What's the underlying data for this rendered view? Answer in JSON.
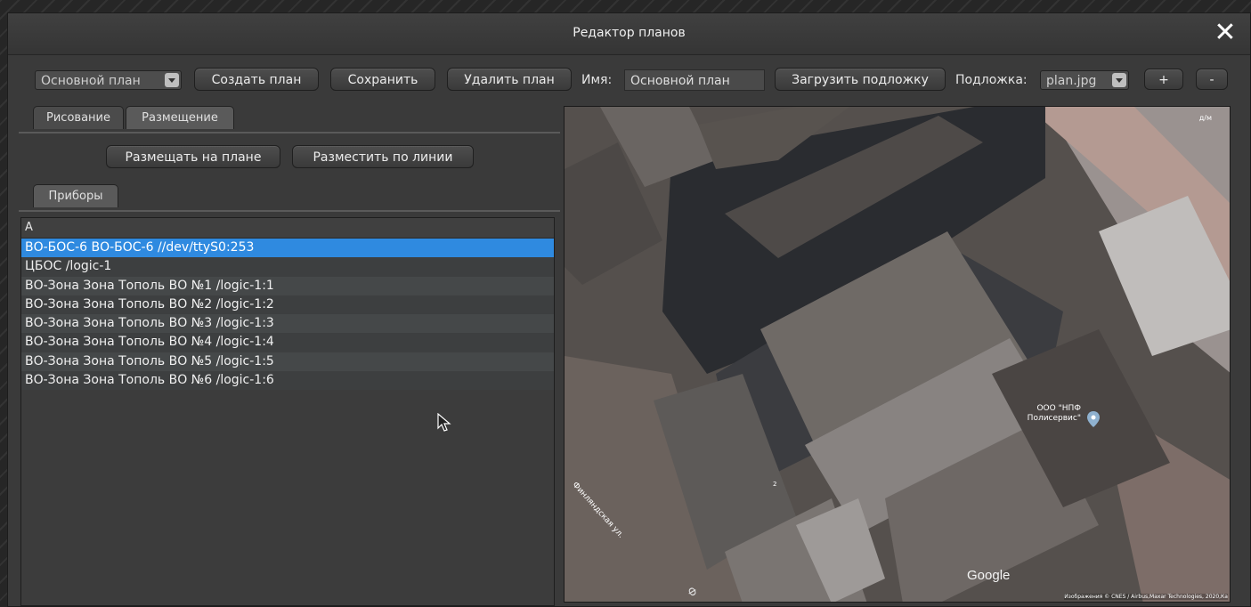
{
  "window": {
    "title": "Редактор планов"
  },
  "toolbar": {
    "plan_select": "Основной план",
    "create_plan": "Создать план",
    "save": "Сохранить",
    "delete_plan": "Удалить план",
    "name_label": "Имя:",
    "name_value": "Основной план",
    "load_background": "Загрузить подложку",
    "background_label": "Подложка:",
    "background_select": "plan.jpg",
    "zoom_in": "+",
    "zoom_out": "-"
  },
  "tabs": [
    {
      "label": "Рисование",
      "active": false
    },
    {
      "label": "Размещение",
      "active": true
    }
  ],
  "placement": {
    "place_on_plan": "Размещать на плане",
    "place_along_line": "Разместить по линии",
    "devices_tab": "Приборы"
  },
  "device_list": {
    "header": "A",
    "items": [
      {
        "label": "ВО-БОС-6 ВО-БОС-6 //dev/ttyS0:253",
        "selected": true
      },
      {
        "label": "ЦБОС  /logic-1",
        "selected": false
      },
      {
        "label": "ВО-Зона Зона Тополь ВО №1 /logic-1:1",
        "selected": false
      },
      {
        "label": "ВО-Зона Зона Тополь ВО №2 /logic-1:2",
        "selected": false
      },
      {
        "label": "ВО-Зона Зона Тополь ВО №3 /logic-1:3",
        "selected": false
      },
      {
        "label": "ВО-Зона Зона Тополь ВО №4 /logic-1:4",
        "selected": false
      },
      {
        "label": "ВО-Зона Зона Тополь ВО №5 /logic-1:5",
        "selected": false
      },
      {
        "label": "ВО-Зона Зона Тополь ВО №6 /logic-1:6",
        "selected": false
      }
    ]
  },
  "map": {
    "label_top_right": "д/м",
    "poi_line1": "ООО \"НПФ",
    "poi_line2": "Полисервис\"",
    "street": "Финляндская ул.",
    "mark_2": "2",
    "google": "Google",
    "attribution": "Изображения © CNES / Airbus,Maxar Technologies, 2020,Ка",
    "street_bottom": "Ф"
  }
}
